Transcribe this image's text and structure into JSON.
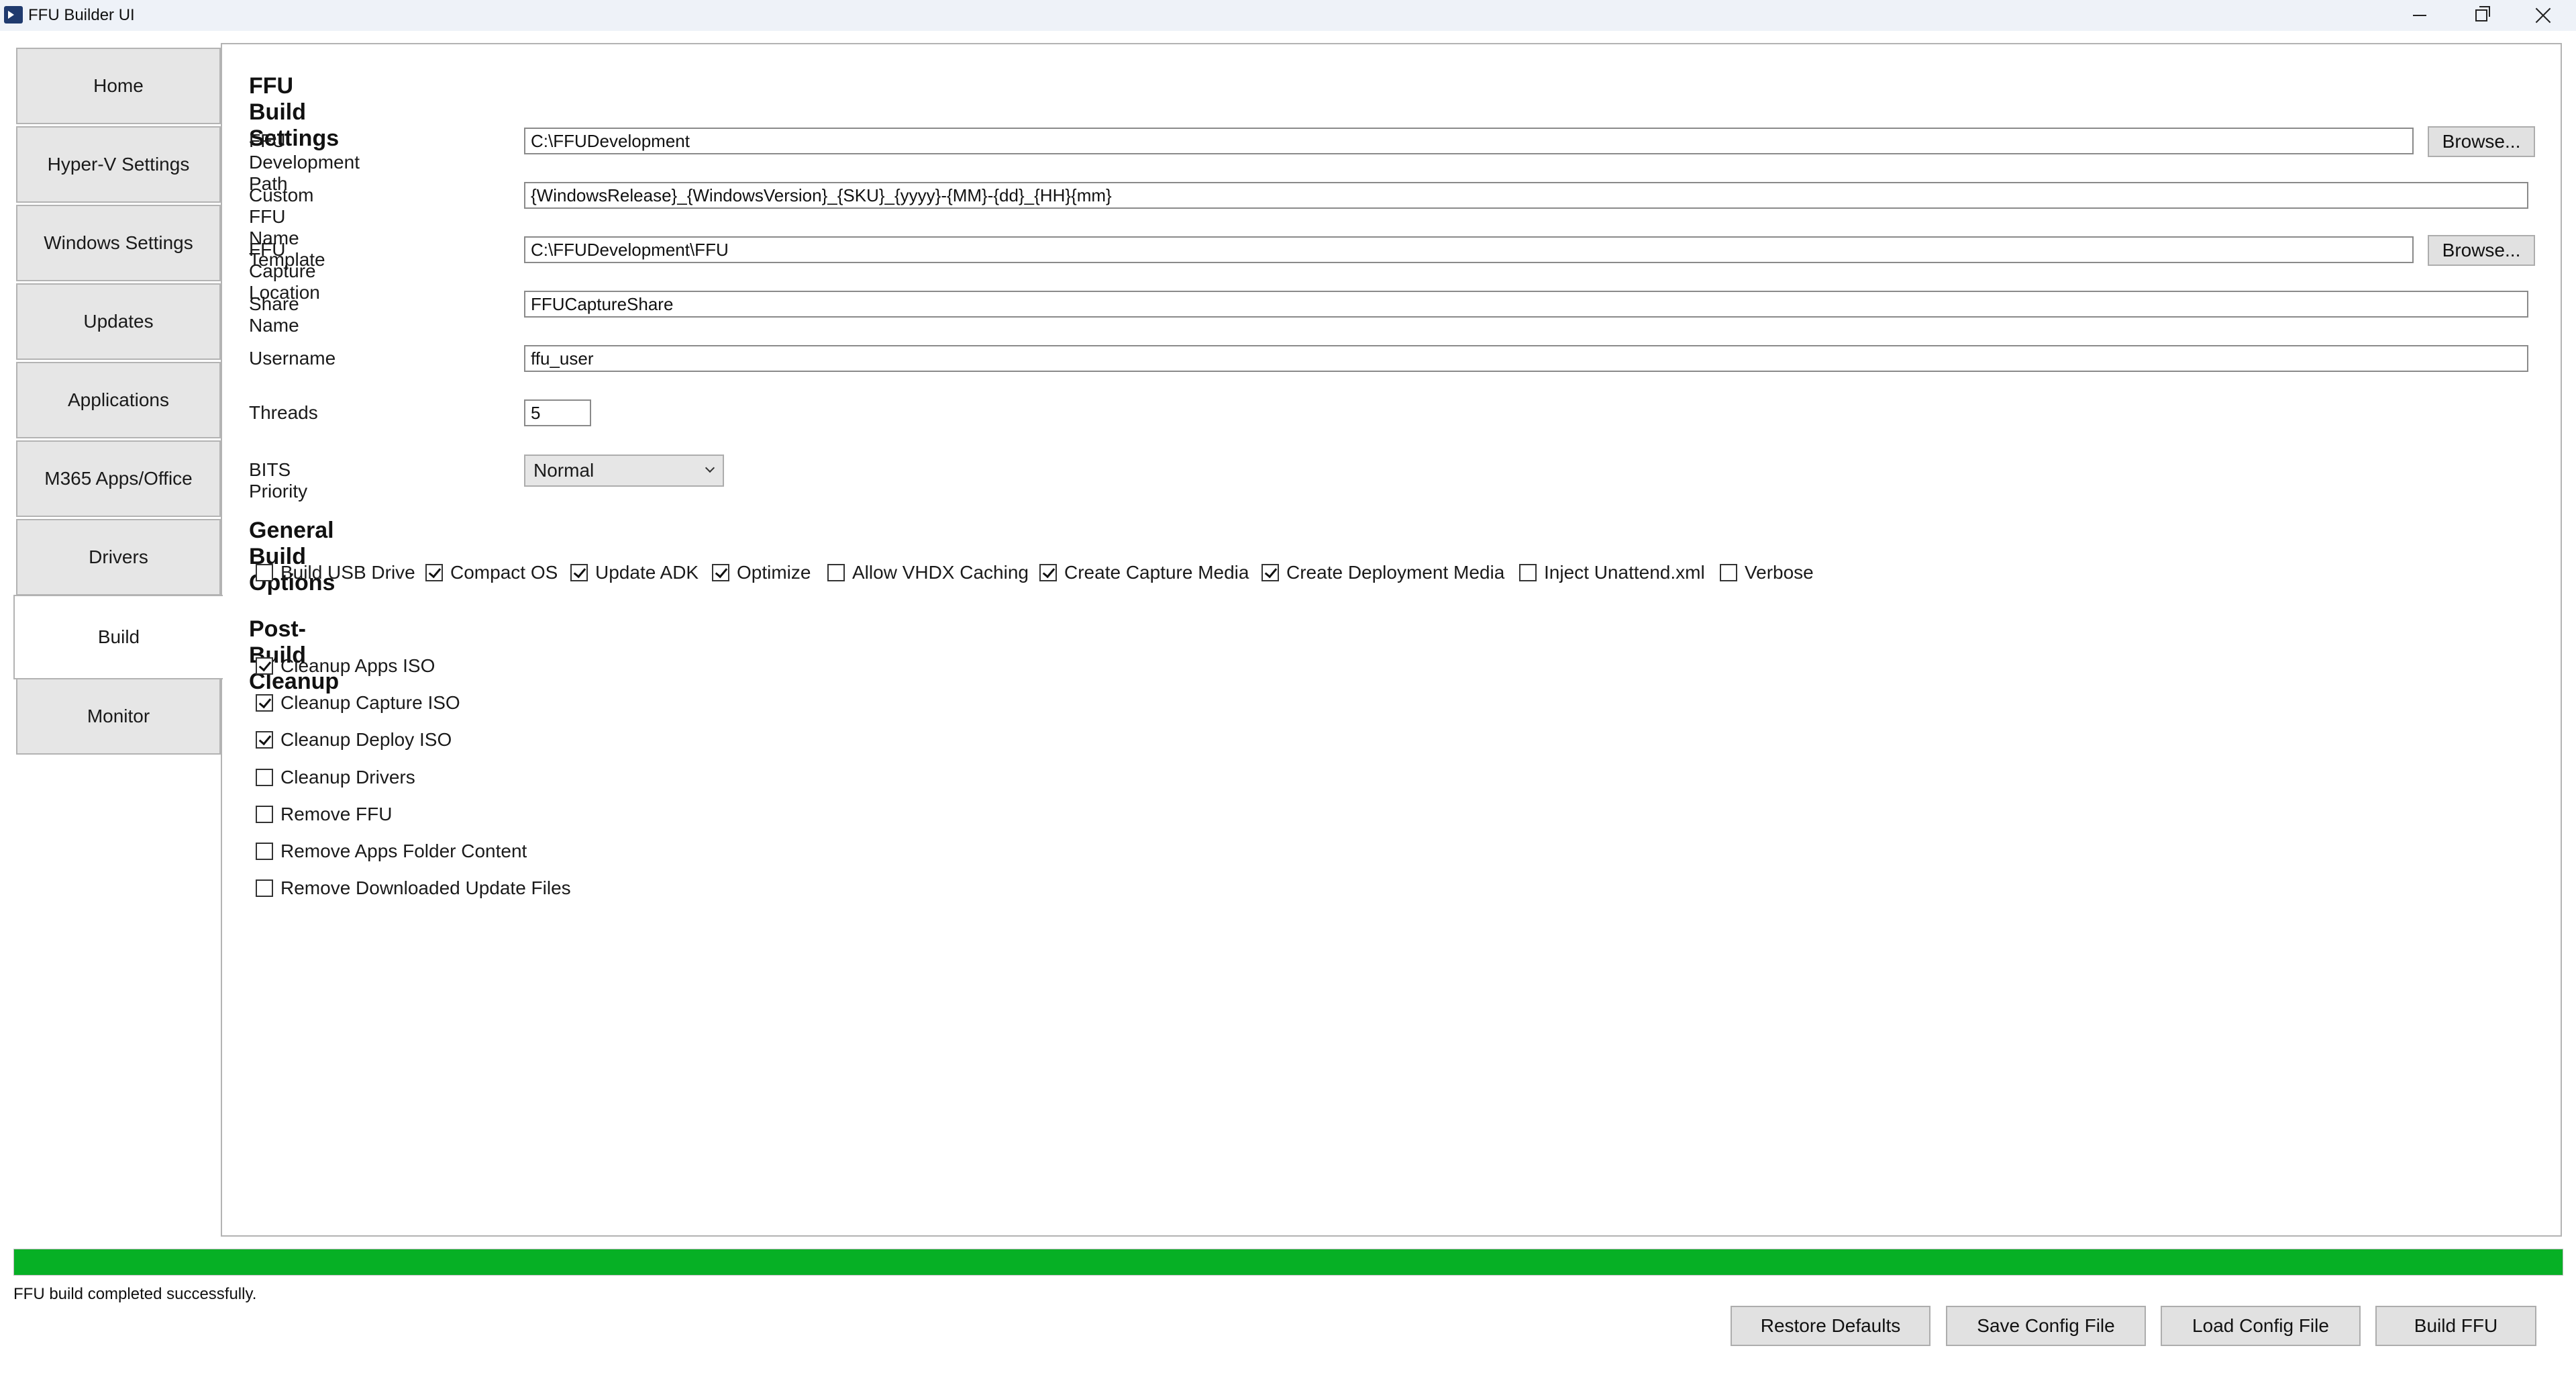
{
  "window": {
    "title": "FFU Builder UI"
  },
  "tabs": [
    "Home",
    "Hyper-V Settings",
    "Windows Settings",
    "Updates",
    "Applications",
    "M365 Apps/Office",
    "Drivers",
    "Build",
    "Monitor"
  ],
  "active_tab": "Build",
  "build_settings": {
    "heading": "FFU Build Settings",
    "dev_path": {
      "label": "FFU Development Path",
      "value": "C:\\FFUDevelopment",
      "browse": "Browse..."
    },
    "name_template": {
      "label": "Custom FFU Name Template",
      "value": "{WindowsRelease}_{WindowsVersion}_{SKU}_{yyyy}-{MM}-{dd}_{HH}{mm}"
    },
    "capture_location": {
      "label": "FFU Capture Location",
      "value": "C:\\FFUDevelopment\\FFU",
      "browse": "Browse..."
    },
    "share_name": {
      "label": "Share Name",
      "value": "FFUCaptureShare"
    },
    "username": {
      "label": "Username",
      "value": "ffu_user"
    },
    "threads": {
      "label": "Threads",
      "value": "5"
    },
    "bits_priority": {
      "label": "BITS Priority",
      "value": "Normal"
    }
  },
  "general_options": {
    "heading": "General Build Options",
    "items": [
      {
        "label": "Build USB Drive",
        "checked": false
      },
      {
        "label": "Compact OS",
        "checked": true
      },
      {
        "label": "Update ADK",
        "checked": true
      },
      {
        "label": "Optimize",
        "checked": true
      },
      {
        "label": "Allow VHDX Caching",
        "checked": false
      },
      {
        "label": "Create Capture Media",
        "checked": true
      },
      {
        "label": "Create Deployment Media",
        "checked": true
      },
      {
        "label": "Inject Unattend.xml",
        "checked": false
      },
      {
        "label": "Verbose",
        "checked": false
      }
    ]
  },
  "cleanup": {
    "heading": "Post-Build Cleanup",
    "items": [
      {
        "label": "Cleanup Apps ISO",
        "checked": true
      },
      {
        "label": "Cleanup Capture ISO",
        "checked": true
      },
      {
        "label": "Cleanup Deploy ISO",
        "checked": true
      },
      {
        "label": "Cleanup Drivers",
        "checked": false
      },
      {
        "label": "Remove FFU",
        "checked": false
      },
      {
        "label": "Remove Apps Folder Content",
        "checked": false
      },
      {
        "label": "Remove Downloaded Update Files",
        "checked": false
      }
    ]
  },
  "progress": {
    "value": 1.0,
    "color": "#06b025"
  },
  "status_text": "FFU build completed successfully.",
  "footer_buttons": {
    "restore": "Restore Defaults",
    "save": "Save Config File",
    "load": "Load Config File",
    "build": "Build FFU"
  }
}
